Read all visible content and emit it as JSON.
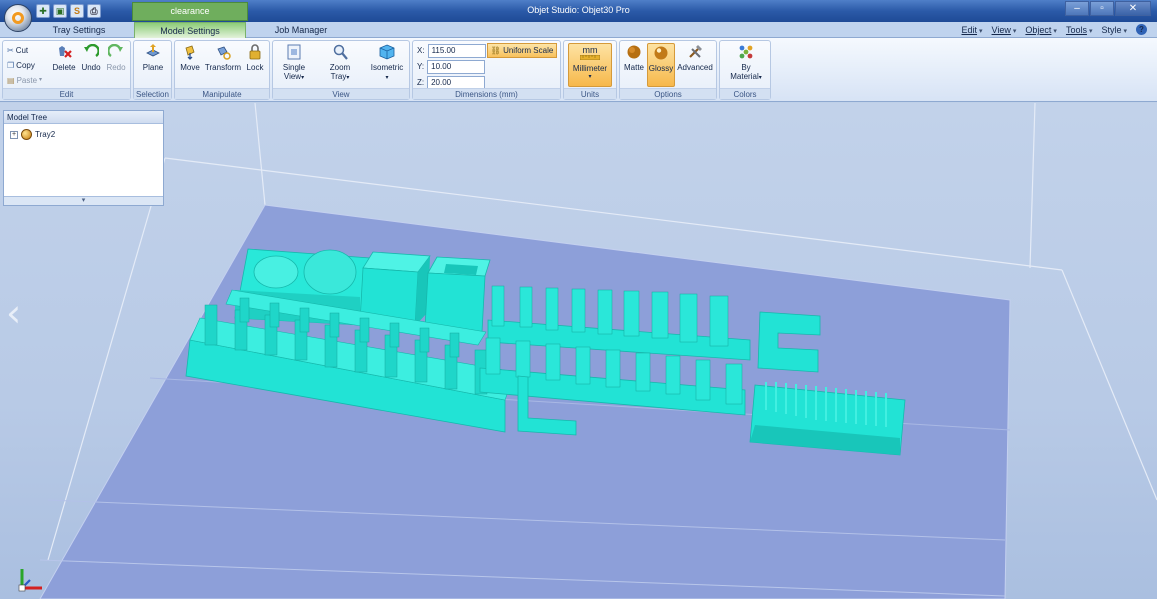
{
  "app": {
    "title": "Objet Studio: Objet30 Pro",
    "contextual_tab": "clearance"
  },
  "tabs": [
    {
      "label": "Tray Settings",
      "active": false
    },
    {
      "label": "Model Settings",
      "active": true
    },
    {
      "label": "Job Manager",
      "active": false
    }
  ],
  "menu": {
    "items": [
      "Edit",
      "View",
      "Object",
      "Tools",
      "Style"
    ],
    "help_icon": "help-icon"
  },
  "window_controls": {
    "minimize": "–",
    "maximize": "▫",
    "close": "✕"
  },
  "ribbon": {
    "edit": {
      "label": "Edit",
      "cut": "Cut",
      "copy": "Copy",
      "paste": "Paste",
      "delete": "Delete",
      "undo": "Undo",
      "redo": "Redo"
    },
    "selection": {
      "label": "Selection",
      "plane": "Plane"
    },
    "manipulate": {
      "label": "Manipulate",
      "move": "Move",
      "transform": "Transform",
      "lock": "Lock"
    },
    "view": {
      "label": "View",
      "single_view_line1": "Single",
      "single_view_line2": "View",
      "zoom_tray_line1": "Zoom",
      "zoom_tray_line2": "Tray",
      "isometric": "Isometric"
    },
    "dimensions": {
      "label": "Dimensions (mm)",
      "x_label": "X:",
      "x_value": "115.00",
      "y_label": "Y:",
      "y_value": "10.00",
      "z_label": "Z:",
      "z_value": "20.00",
      "uniform_scale": "Uniform Scale"
    },
    "units": {
      "label": "Units",
      "mm": "mm",
      "millimeter": "Millimeter"
    },
    "options": {
      "label": "Options",
      "matte": "Matte",
      "glossy": "Glossy",
      "advanced": "Advanced"
    },
    "colors": {
      "label": "Colors",
      "by_line1": "By",
      "by_line2": "Material"
    }
  },
  "model_tree": {
    "title": "Model Tree",
    "items": [
      {
        "label": "Tray2",
        "expand": "+"
      }
    ],
    "footer_arrow": "▾"
  },
  "viewport": {
    "nav_left": "‹",
    "model_color": "#21e3d5",
    "tray_color": "#8b9dd8"
  }
}
